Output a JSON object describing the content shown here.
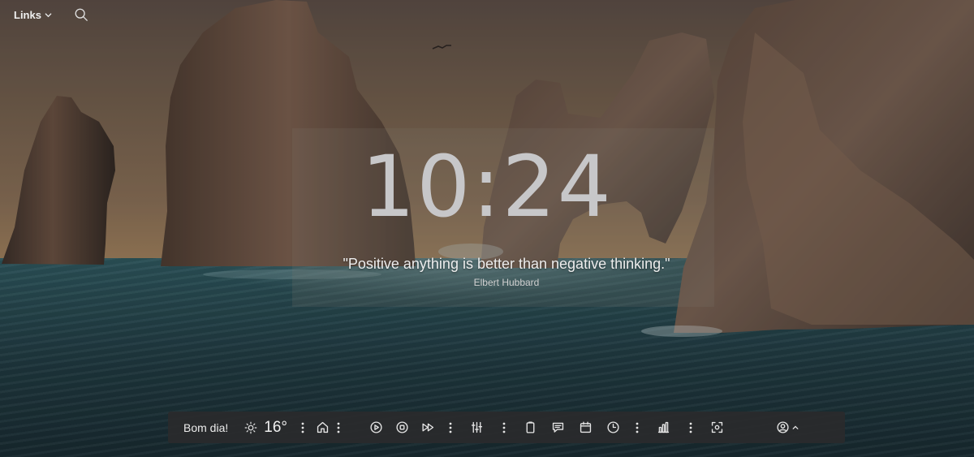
{
  "header": {
    "links_label": "Links",
    "icons": {
      "links_menu": "chevron-down-icon",
      "search": "search-icon"
    }
  },
  "clock": {
    "time": "10:24"
  },
  "quote": {
    "text": "\"Positive anything is better than negative thinking.\"",
    "author": "Elbert Hubbard"
  },
  "bottom_bar": {
    "greeting": "Bom dia!",
    "weather": {
      "icon": "sun-icon",
      "temperature": "16°"
    },
    "icons": [
      "more-vertical-icon",
      "home-icon",
      "more-vertical-icon",
      "play-icon",
      "stop-icon",
      "fast-forward-icon",
      "more-vertical-icon",
      "sliders-icon",
      "more-vertical-icon",
      "clipboard-icon",
      "message-icon",
      "calendar-icon",
      "clock-icon",
      "more-vertical-icon",
      "bar-chart-icon",
      "more-vertical-icon",
      "focus-scan-icon",
      "user-circle-icon",
      "chevron-up-icon"
    ]
  },
  "colors": {
    "bar_background": "#2a2a2c",
    "clock_text": "#c7c7c9",
    "icon_stroke": "#e5e5e5"
  }
}
